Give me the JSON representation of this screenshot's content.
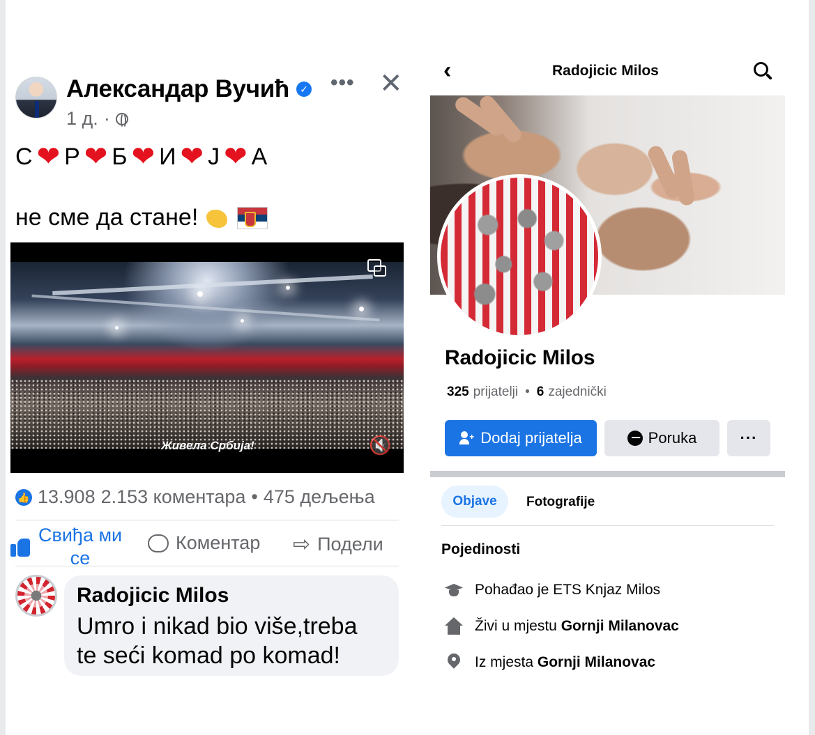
{
  "post": {
    "author": "Александар Вучић",
    "time": "1 д.",
    "line1_letters": [
      "С",
      "Р",
      "Б",
      "И",
      "Ј",
      "А"
    ],
    "line2_text": "не сме да стане!",
    "emoji_1": "flexed-biceps",
    "emoji_2": "serbian-flag",
    "video": {
      "caption": "Живела Србија!"
    },
    "stats": {
      "likes": "13.908",
      "comments": "2.153 коментара",
      "separator": "•",
      "shares": "475 дељења"
    },
    "actions": {
      "like_line1": "Свиђа ми",
      "like_line2": "се",
      "comment": "Коментар",
      "share": "Подели"
    },
    "comment": {
      "author": "Radojicic Milos",
      "text_line1": "Umro i nikad bio više,treba",
      "text_line2": "te seći komad po komad!"
    }
  },
  "profile": {
    "header_title": "Radojicic Milos",
    "name": "Radojicic Milos",
    "friends_count": "325",
    "friends_label": "prijatelji",
    "dot": "•",
    "mutual_count": "6",
    "mutual_label": "zajednički",
    "buttons": {
      "add_friend": "Dodaj prijatelja",
      "message": "Poruka",
      "more": "···"
    },
    "tabs": {
      "posts": "Objave",
      "photos": "Fotografije"
    },
    "details_title": "Pojedinosti",
    "details": [
      {
        "icon": "graduation-cap-icon",
        "prefix": "Pohađao je ETS Knjaz Milos",
        "bold": ""
      },
      {
        "icon": "house-icon",
        "prefix": "Živi u mjestu",
        "bold": "Gornji Milanovac"
      },
      {
        "icon": "location-pin-icon",
        "prefix": "Iz mjesta",
        "bold": "Gornji Milanovac"
      }
    ]
  },
  "colors": {
    "facebook_blue": "#1b74e4",
    "heart_red": "#e4111e",
    "secondary_text": "#65676b"
  }
}
